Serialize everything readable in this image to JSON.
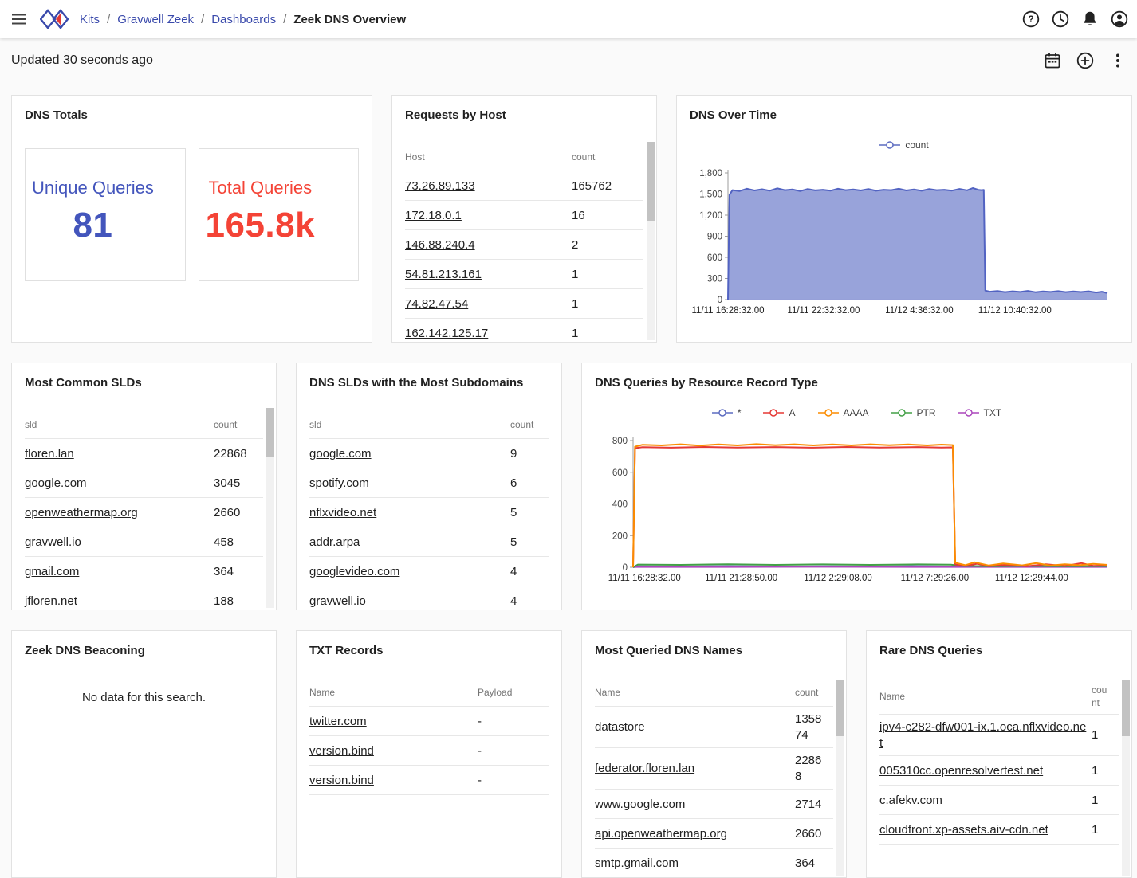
{
  "navbar": {
    "breadcrumb": {
      "items": [
        {
          "label": "Kits"
        },
        {
          "label": "Gravwell Zeek"
        },
        {
          "label": "Dashboards"
        }
      ],
      "separator": "/",
      "current": "Zeek DNS Overview"
    },
    "icons": [
      {
        "name": "help-icon"
      },
      {
        "name": "history-icon"
      },
      {
        "name": "notifications-icon"
      },
      {
        "name": "account-icon"
      }
    ]
  },
  "toolbar": {
    "updated_text": "Updated 30 seconds ago",
    "icons": [
      {
        "name": "date-range-icon"
      },
      {
        "name": "add-circle-icon"
      },
      {
        "name": "more-vert-icon"
      }
    ]
  },
  "colors": {
    "link_blue": "#3949ab",
    "indigo_accent": "#3f51b5",
    "red_accent": "#f44336",
    "area_fill": "#8f9bd7"
  },
  "cards": {
    "dns_totals": {
      "title": "DNS Totals",
      "tiles": [
        {
          "label": "Unique Queries",
          "value": "81",
          "color": "#3f51b5"
        },
        {
          "label": "Total Queries",
          "value": "165.8k",
          "color": "#f44336"
        }
      ]
    },
    "requests_by_host": {
      "title": "Requests by Host",
      "table": {
        "headers": [
          "Host",
          "count"
        ],
        "rows": [
          {
            "cells": [
              "73.26.89.133",
              "165762"
            ],
            "link": true
          },
          {
            "cells": [
              "172.18.0.1",
              "16"
            ],
            "link": true
          },
          {
            "cells": [
              "146.88.240.4",
              "2"
            ],
            "link": true
          },
          {
            "cells": [
              "54.81.213.161",
              "1"
            ],
            "link": true
          },
          {
            "cells": [
              "74.82.47.54",
              "1"
            ],
            "link": true
          },
          {
            "cells": [
              "162.142.125.17",
              "1"
            ],
            "link": true
          }
        ]
      }
    },
    "dns_over_time": {
      "title": "DNS Over Time"
    },
    "most_common_slds": {
      "title": "Most Common SLDs",
      "table": {
        "headers": [
          "sld",
          "count"
        ],
        "rows": [
          {
            "cells": [
              "floren.lan",
              "22868"
            ],
            "link": true
          },
          {
            "cells": [
              "google.com",
              "3045"
            ],
            "link": true
          },
          {
            "cells": [
              "openweathermap.org",
              "2660"
            ],
            "link": true
          },
          {
            "cells": [
              "gravwell.io",
              "458"
            ],
            "link": true
          },
          {
            "cells": [
              "gmail.com",
              "364"
            ],
            "link": true
          },
          {
            "cells": [
              "jfloren.net",
              "188"
            ],
            "link": true
          }
        ]
      }
    },
    "slds_most_subdomains": {
      "title": "DNS SLDs with the Most Subdomains",
      "table": {
        "headers": [
          "sld",
          "count"
        ],
        "rows": [
          {
            "cells": [
              "google.com",
              "9"
            ],
            "link": true
          },
          {
            "cells": [
              "spotify.com",
              "6"
            ],
            "link": true
          },
          {
            "cells": [
              "nflxvideo.net",
              "5"
            ],
            "link": true
          },
          {
            "cells": [
              "addr.arpa",
              "5"
            ],
            "link": true
          },
          {
            "cells": [
              "googlevideo.com",
              "4"
            ],
            "link": true
          },
          {
            "cells": [
              "gravwell.io",
              "4"
            ],
            "link": true
          }
        ]
      }
    },
    "rr_types": {
      "title": "DNS Queries by Resource Record Type"
    },
    "beaconing": {
      "title": "Zeek DNS Beaconing",
      "empty_text": "No data for this search."
    },
    "txt_records": {
      "title": "TXT Records",
      "table": {
        "headers": [
          "Name",
          "Payload"
        ],
        "rows": [
          {
            "cells": [
              "twitter.com",
              "-"
            ],
            "link": true
          },
          {
            "cells": [
              "version.bind",
              "-"
            ],
            "link": true
          },
          {
            "cells": [
              "version.bind",
              "-"
            ],
            "link": true
          }
        ]
      }
    },
    "most_queried": {
      "title": "Most Queried DNS Names",
      "table": {
        "headers": [
          "Name",
          "count"
        ],
        "rows": [
          {
            "cells": [
              "datastore",
              "135874"
            ],
            "link": false
          },
          {
            "cells": [
              "federator.floren.lan",
              "22868"
            ],
            "link": true
          },
          {
            "cells": [
              "www.google.com",
              "2714"
            ],
            "link": true
          },
          {
            "cells": [
              "api.openweathermap.org",
              "2660"
            ],
            "link": true
          },
          {
            "cells": [
              "smtp.gmail.com",
              "364"
            ],
            "link": true
          }
        ]
      }
    },
    "rare_queries": {
      "title": "Rare DNS Queries",
      "table": {
        "headers": [
          "Name",
          "count"
        ],
        "rows": [
          {
            "cells": [
              "ipv4-c282-dfw001-ix.1.oca.nflxvideo.net",
              "1"
            ],
            "link": true
          },
          {
            "cells": [
              "005310cc.openresolvertest.net",
              "1"
            ],
            "link": true
          },
          {
            "cells": [
              "c.afekv.com",
              "1"
            ],
            "link": true
          },
          {
            "cells": [
              "cloudfront.xp-assets.aiv-cdn.net",
              "1"
            ],
            "link": true
          }
        ]
      }
    }
  },
  "chart_data": [
    {
      "id": "dns_over_time",
      "type": "area",
      "title": "DNS Over Time",
      "legend": [
        {
          "name": "count",
          "color": "#5c6bc0"
        }
      ],
      "ylim": [
        0,
        1800
      ],
      "yticks": [
        {
          "v": 0,
          "label": "0"
        },
        {
          "v": 300,
          "label": "300"
        },
        {
          "v": 600,
          "label": "600"
        },
        {
          "v": 900,
          "label": "900"
        },
        {
          "v": 1200,
          "label": "1,200"
        },
        {
          "v": 1500,
          "label": "1,500"
        },
        {
          "v": 1800,
          "label": "1,800"
        }
      ],
      "xticks": [
        {
          "pos": 0.0,
          "label": "11/11 16:28:32.00"
        },
        {
          "pos": 0.252,
          "label": "11/11 22:32:32.00"
        },
        {
          "pos": 0.504,
          "label": "11/12 4:36:32.00"
        },
        {
          "pos": 0.756,
          "label": "11/12 10:40:32.00"
        }
      ],
      "series": [
        {
          "name": "count",
          "color": "#5263c2",
          "fill": "#8f9bd7",
          "fill_opacity": 0.92,
          "points": [
            [
              0,
              0
            ],
            [
              0.004,
              1490
            ],
            [
              0.012,
              1556
            ],
            [
              0.03,
              1542
            ],
            [
              0.05,
              1576
            ],
            [
              0.07,
              1551
            ],
            [
              0.09,
              1568
            ],
            [
              0.11,
              1547
            ],
            [
              0.13,
              1581
            ],
            [
              0.15,
              1556
            ],
            [
              0.17,
              1566
            ],
            [
              0.19,
              1542
            ],
            [
              0.21,
              1571
            ],
            [
              0.23,
              1552
            ],
            [
              0.25,
              1561
            ],
            [
              0.27,
              1547
            ],
            [
              0.29,
              1576
            ],
            [
              0.31,
              1556
            ],
            [
              0.33,
              1566
            ],
            [
              0.35,
              1551
            ],
            [
              0.37,
              1571
            ],
            [
              0.39,
              1546
            ],
            [
              0.41,
              1561
            ],
            [
              0.43,
              1556
            ],
            [
              0.45,
              1576
            ],
            [
              0.47,
              1551
            ],
            [
              0.49,
              1566
            ],
            [
              0.51,
              1546
            ],
            [
              0.53,
              1571
            ],
            [
              0.55,
              1556
            ],
            [
              0.57,
              1561
            ],
            [
              0.59,
              1549
            ],
            [
              0.61,
              1573
            ],
            [
              0.63,
              1553
            ],
            [
              0.645,
              1585
            ],
            [
              0.66,
              1560
            ],
            [
              0.668,
              1556
            ],
            [
              0.674,
              1560
            ],
            [
              0.678,
              128
            ],
            [
              0.69,
              112
            ],
            [
              0.71,
              121
            ],
            [
              0.73,
              106
            ],
            [
              0.75,
              118
            ],
            [
              0.77,
              109
            ],
            [
              0.79,
              123
            ],
            [
              0.81,
              105
            ],
            [
              0.83,
              116
            ],
            [
              0.85,
              109
            ],
            [
              0.87,
              120
            ],
            [
              0.89,
              106
            ],
            [
              0.91,
              117
            ],
            [
              0.93,
              108
            ],
            [
              0.95,
              118
            ],
            [
              0.97,
              101
            ],
            [
              0.985,
              112
            ],
            [
              1,
              92
            ]
          ]
        }
      ]
    },
    {
      "id": "dns_queries_by_rr_type",
      "type": "line",
      "title": "DNS Queries by Resource Record Type",
      "legend": [
        {
          "name": "*",
          "color": "#5c6bc0"
        },
        {
          "name": "A",
          "color": "#e53935"
        },
        {
          "name": "AAAA",
          "color": "#fb8c00"
        },
        {
          "name": "PTR",
          "color": "#43a047"
        },
        {
          "name": "TXT",
          "color": "#ab47bc"
        }
      ],
      "ylim": [
        0,
        800
      ],
      "yticks": [
        {
          "v": 0,
          "label": "0"
        },
        {
          "v": 200,
          "label": "200"
        },
        {
          "v": 400,
          "label": "400"
        },
        {
          "v": 600,
          "label": "600"
        },
        {
          "v": 800,
          "label": "800"
        }
      ],
      "xticks": [
        {
          "pos": 0.024,
          "label": "11/11 16:28:32.00"
        },
        {
          "pos": 0.228,
          "label": "11/11 21:28:50.00"
        },
        {
          "pos": 0.432,
          "label": "11/12 2:29:08.00"
        },
        {
          "pos": 0.636,
          "label": "11/12 7:29:26.00"
        },
        {
          "pos": 0.84,
          "label": "11/12 12:29:44.00"
        }
      ],
      "series": [
        {
          "name": "*",
          "color": "#5c6bc0",
          "points": [
            [
              0,
              0
            ],
            [
              0.01,
              6
            ],
            [
              0.1,
              5
            ],
            [
              0.2,
              7
            ],
            [
              0.3,
              5
            ],
            [
              0.4,
              6
            ],
            [
              0.5,
              5
            ],
            [
              0.6,
              7
            ],
            [
              0.67,
              5
            ],
            [
              0.7,
              4
            ],
            [
              0.8,
              3
            ],
            [
              0.9,
              4
            ],
            [
              1,
              4
            ]
          ]
        },
        {
          "name": "TXT",
          "color": "#ab47bc",
          "points": [
            [
              0,
              2
            ],
            [
              0.2,
              2
            ],
            [
              0.4,
              3
            ],
            [
              0.6,
              2
            ],
            [
              0.8,
              2
            ],
            [
              1,
              2
            ]
          ]
        },
        {
          "name": "PTR",
          "color": "#43a047",
          "points": [
            [
              0,
              0
            ],
            [
              0.01,
              17
            ],
            [
              0.1,
              15
            ],
            [
              0.2,
              19
            ],
            [
              0.3,
              15
            ],
            [
              0.4,
              18
            ],
            [
              0.5,
              15
            ],
            [
              0.6,
              18
            ],
            [
              0.67,
              16
            ],
            [
              0.69,
              9
            ],
            [
              0.75,
              6
            ],
            [
              0.82,
              8
            ],
            [
              0.9,
              6
            ],
            [
              1,
              7
            ]
          ]
        },
        {
          "name": "A",
          "color": "#e53935",
          "points": [
            [
              0,
              0
            ],
            [
              0.004,
              752
            ],
            [
              0.02,
              758
            ],
            [
              0.08,
              755
            ],
            [
              0.15,
              760
            ],
            [
              0.22,
              756
            ],
            [
              0.3,
              759
            ],
            [
              0.38,
              755
            ],
            [
              0.45,
              760
            ],
            [
              0.52,
              756
            ],
            [
              0.6,
              759
            ],
            [
              0.65,
              756
            ],
            [
              0.674,
              757
            ],
            [
              0.679,
              18
            ],
            [
              0.7,
              8
            ],
            [
              0.725,
              22
            ],
            [
              0.75,
              7
            ],
            [
              0.79,
              16
            ],
            [
              0.83,
              6
            ],
            [
              0.87,
              19
            ],
            [
              0.91,
              8
            ],
            [
              0.945,
              26
            ],
            [
              0.97,
              9
            ],
            [
              1,
              11
            ]
          ]
        },
        {
          "name": "AAAA",
          "color": "#fb8c00",
          "points": [
            [
              0,
              0
            ],
            [
              0.004,
              762
            ],
            [
              0.02,
              774
            ],
            [
              0.06,
              770
            ],
            [
              0.1,
              777
            ],
            [
              0.14,
              769
            ],
            [
              0.18,
              776
            ],
            [
              0.22,
              770
            ],
            [
              0.26,
              778
            ],
            [
              0.3,
              771
            ],
            [
              0.34,
              777
            ],
            [
              0.38,
              770
            ],
            [
              0.42,
              776
            ],
            [
              0.46,
              770
            ],
            [
              0.5,
              777
            ],
            [
              0.54,
              771
            ],
            [
              0.58,
              776
            ],
            [
              0.62,
              770
            ],
            [
              0.65,
              775
            ],
            [
              0.674,
              772
            ],
            [
              0.679,
              28
            ],
            [
              0.7,
              13
            ],
            [
              0.72,
              31
            ],
            [
              0.75,
              11
            ],
            [
              0.78,
              24
            ],
            [
              0.82,
              12
            ],
            [
              0.85,
              26
            ],
            [
              0.88,
              11
            ],
            [
              0.91,
              19
            ],
            [
              0.94,
              13
            ],
            [
              0.97,
              21
            ],
            [
              1,
              15
            ]
          ]
        }
      ]
    }
  ]
}
